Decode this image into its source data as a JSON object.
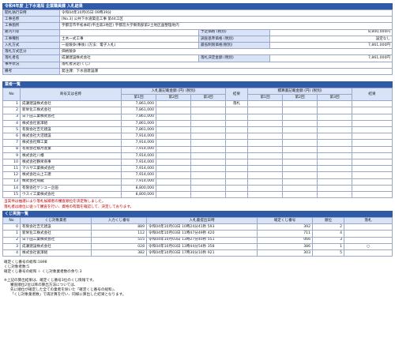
{
  "header": {
    "title": "令和4年度 上下水道局 企業職員課 入札結果"
  },
  "info": {
    "rows": [
      {
        "label": "開札執行日時",
        "value": "令和04年10月05日 09時39分"
      },
      {
        "label": "工事名称",
        "value": "[No.3] 公共下水道築造工事 第44工区"
      },
      {
        "label": "工事箇所",
        "value": "宇都宮市平松本町(平出第2地区) 宇都宮大学東南部第2土地区画整理地内"
      }
    ],
    "pairs": [
      {
        "l1": "路河川等",
        "v1": "",
        "l2": "予定価格 (税別)",
        "v2": "8,800,000円"
      },
      {
        "l1": "工事種別",
        "v1": "土木一式工事",
        "l2": "調査基準価格 (税別)",
        "v2": "設定なし"
      },
      {
        "l1": "入札方式",
        "v1": "一般競争(事後) (方法：電子入札)",
        "l2": "最低制限価格(税別)",
        "v2": "7,861,000円"
      }
    ],
    "type_row": {
      "label": "落札方式区分",
      "value": "価格競争"
    },
    "winner_row": {
      "l1": "落札者名",
      "v1": "成瀬建設株式会社",
      "l2": "落札決定金額 (税別)",
      "v2": "7,861,000円"
    },
    "status_row": {
      "label": "事件状況",
      "value": "落札者決定(くじ)"
    },
    "note_row": {
      "label": "備考",
      "value": "発注課：下水道建設課"
    }
  },
  "bidders": {
    "title": "業者一覧",
    "col_no": "No",
    "col_name": "商号又は名称",
    "col_round1": "入札書記載金額 (円) (税別)",
    "col_result": "結果",
    "col_round2": "積算書記載金額 (円) (税別)",
    "col_result2": "結果",
    "sub": [
      "第1回",
      "第2回",
      "第3回"
    ],
    "rows": [
      {
        "no": "1",
        "name": "成瀬建設株式会社",
        "r1": "7,861,000",
        "result": "落札"
      },
      {
        "no": "2",
        "name": "新栄化工株式会社",
        "r1": "7,861,000",
        "result": ""
      },
      {
        "no": "3",
        "name": "日下田工業株式会社",
        "r1": "7,861,000",
        "result": ""
      },
      {
        "no": "4",
        "name": "株式会社富澤組",
        "r1": "7,861,000",
        "result": ""
      },
      {
        "no": "5",
        "name": "有限会社吉元建設",
        "r1": "7,861,000",
        "result": ""
      },
      {
        "no": "6",
        "name": "株式会社大沼建設",
        "r1": "7,914,000",
        "result": ""
      },
      {
        "no": "7",
        "name": "株式会社輝工業",
        "r1": "7,914,000",
        "result": ""
      },
      {
        "no": "8",
        "name": "有限会社積月産業",
        "r1": "7,914,000",
        "result": ""
      },
      {
        "no": "9",
        "name": "株式会社八幡",
        "r1": "7,914,000",
        "result": ""
      },
      {
        "no": "10",
        "name": "株式会社鶴栄商事",
        "r1": "7,914,000",
        "result": ""
      },
      {
        "no": "11",
        "name": "マルサ工業株式会社",
        "r1": "7,914,000",
        "result": ""
      },
      {
        "no": "12",
        "name": "株式会社山上工建",
        "r1": "7,914,000",
        "result": ""
      },
      {
        "no": "13",
        "name": "株式会社飛龍",
        "r1": "7,914,000",
        "result": ""
      },
      {
        "no": "14",
        "name": "有限会社ケンユー企画",
        "r1": "8,800,000",
        "result": ""
      },
      {
        "no": "15",
        "name": "ウスイ工業株式会社",
        "r1": "8,800,000",
        "result": ""
      }
    ]
  },
  "notice": [
    "当案件は抽選により落札候補者の審査順位を決定致しました。",
    "落札者は順位に従って審査を行い、資格の有無を確認して、決定しております。"
  ],
  "lottery": {
    "title": "くじ実施一覧",
    "cols": [
      "No",
      "くじ対象業者",
      "入力くじ番号",
      "入札書提出日時",
      "確定くじ番号",
      "順位",
      "落札"
    ],
    "rows": [
      {
        "no": "0",
        "name": "有限会社吉元建設",
        "input": "889",
        "time": "令和04年10月03日 10時24分41秒 593",
        "fixed": "392",
        "rank": "2",
        "win": ""
      },
      {
        "no": "1",
        "name": "新栄化工株式会社",
        "input": "112",
        "time": "令和04年10月03日 11時47分49秒 420",
        "fixed": "711",
        "rank": "4",
        "win": ""
      },
      {
        "no": "2",
        "name": "日下田工業株式会社",
        "input": "515",
        "time": "令和04年10月03日 13時27分40秒 551",
        "fixed": "066",
        "rank": "3",
        "win": ""
      },
      {
        "no": "3",
        "name": "成瀬建設株式会社",
        "input": "028",
        "time": "令和04年10月03日 13時44分54秒 358",
        "fixed": "386",
        "rank": "1",
        "win": "○"
      },
      {
        "no": "4",
        "name": "株式会社富澤組",
        "input": "382",
        "time": "令和04年10月03日 17時30分10秒 921",
        "fixed": "303",
        "rank": "5",
        "win": ""
      }
    ]
  },
  "summary": [
    "確定くじ番号の総和:1898",
    "くじ対象者数:5",
    "確定くじ番号の総和 ÷ くじ対象業者数の余り:3"
  ],
  "footnote": [
    "※上記の算出結果は、確定くじ番号3位のくじ情報です。",
    "審査順位2位以降の算出方法については、",
    "先に順位が確定した全ての業者を除いた「確定くじ番号の総和」、",
    "「くじ対象業者数」で再計算を行い、同様に算出した結果となります。"
  ]
}
